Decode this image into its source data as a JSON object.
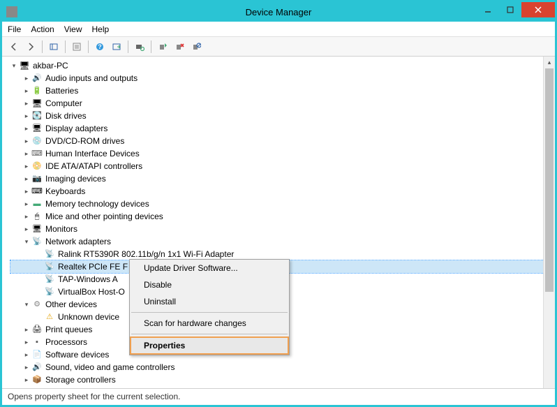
{
  "window": {
    "title": "Device Manager"
  },
  "menu": {
    "file": "File",
    "action": "Action",
    "view": "View",
    "help": "Help"
  },
  "tree": {
    "root": "akbar-PC",
    "categories": [
      {
        "label": "Audio inputs and outputs",
        "icon": "audio",
        "expanded": false
      },
      {
        "label": "Batteries",
        "icon": "battery",
        "expanded": false
      },
      {
        "label": "Computer",
        "icon": "computer",
        "expanded": false
      },
      {
        "label": "Disk drives",
        "icon": "disk",
        "expanded": false
      },
      {
        "label": "Display adapters",
        "icon": "display",
        "expanded": false
      },
      {
        "label": "DVD/CD-ROM drives",
        "icon": "dvd",
        "expanded": false
      },
      {
        "label": "Human Interface Devices",
        "icon": "hid",
        "expanded": false
      },
      {
        "label": "IDE ATA/ATAPI controllers",
        "icon": "ide",
        "expanded": false
      },
      {
        "label": "Imaging devices",
        "icon": "imaging",
        "expanded": false
      },
      {
        "label": "Keyboards",
        "icon": "keyboard",
        "expanded": false
      },
      {
        "label": "Memory technology devices",
        "icon": "memory",
        "expanded": false
      },
      {
        "label": "Mice and other pointing devices",
        "icon": "mouse",
        "expanded": false
      },
      {
        "label": "Monitors",
        "icon": "monitor",
        "expanded": false
      },
      {
        "label": "Network adapters",
        "icon": "network",
        "expanded": true,
        "children": [
          {
            "label": "Ralink RT5390R 802.11b/g/n 1x1 Wi-Fi Adapter",
            "icon": "network"
          },
          {
            "label": "Realtek PCIe FE F",
            "icon": "network",
            "selected": true
          },
          {
            "label": "TAP-Windows A",
            "icon": "network"
          },
          {
            "label": "VirtualBox Host-O",
            "icon": "network"
          }
        ]
      },
      {
        "label": "Other devices",
        "icon": "other",
        "expanded": true,
        "children": [
          {
            "label": "Unknown device",
            "icon": "unknown"
          }
        ]
      },
      {
        "label": "Print queues",
        "icon": "print",
        "expanded": false
      },
      {
        "label": "Processors",
        "icon": "processor",
        "expanded": false
      },
      {
        "label": "Software devices",
        "icon": "software",
        "expanded": false
      },
      {
        "label": "Sound, video and game controllers",
        "icon": "sound",
        "expanded": false
      },
      {
        "label": "Storage controllers",
        "icon": "storage",
        "expanded": false
      }
    ]
  },
  "context_menu": {
    "items": [
      {
        "label": "Update Driver Software...",
        "type": "item"
      },
      {
        "label": "Disable",
        "type": "item"
      },
      {
        "label": "Uninstall",
        "type": "item"
      },
      {
        "type": "sep"
      },
      {
        "label": "Scan for hardware changes",
        "type": "item"
      },
      {
        "type": "sep"
      },
      {
        "label": "Properties",
        "type": "item",
        "highlighted": true
      }
    ]
  },
  "statusbar": {
    "text": "Opens property sheet for the current selection."
  }
}
